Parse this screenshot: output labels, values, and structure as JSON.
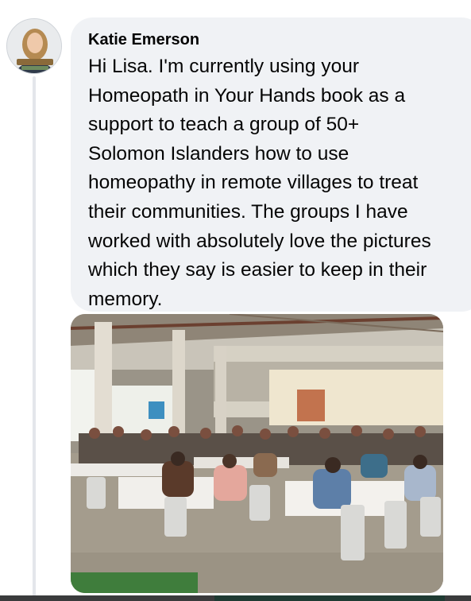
{
  "comment": {
    "author": "Katie Emerson",
    "text": "Hi Lisa. I'm currently using your\nHomeopath in Your Hands book as a\nsupport to teach a group of 50+\nSolomon Islanders how to use\nhomeopathy in remote villages to treat\ntheir communities. The groups I have\nworked with absolutely love the pictures\nwhich they say is easier to keep in their\nmemory."
  },
  "icons": {
    "avatar": "profile-photo",
    "attachment": "photo-classroom-hall"
  },
  "colors": {
    "bubble_background": "#f0f2f5",
    "text": "#050505",
    "thread_line": "#e4e6eb"
  }
}
